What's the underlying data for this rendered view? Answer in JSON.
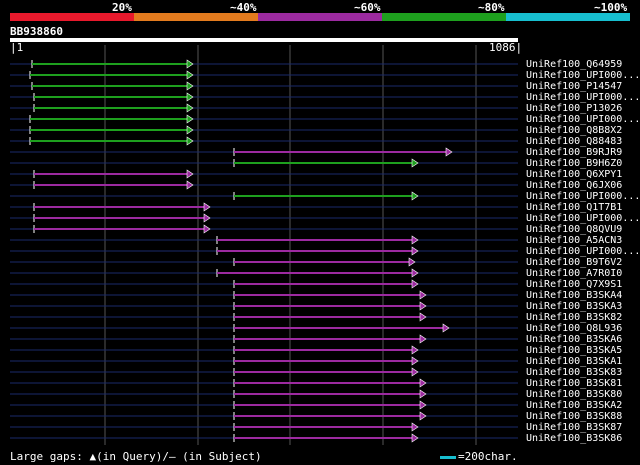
{
  "legend": {
    "labels": [
      "20%",
      "~40%",
      "~60%",
      "~80%",
      "~100%"
    ],
    "colors": [
      "#e8192c",
      "#e37b1e",
      "#9c2aa0",
      "#1ea01e",
      "#17becf"
    ]
  },
  "query": {
    "id": "BB938860",
    "start": "1",
    "end": "1086"
  },
  "footer": {
    "text": "Large gaps: ▲(in Query)/– (in Subject)",
    "scale_label": "=200char."
  },
  "hits": [
    {
      "name": "UniRef100_Q64959",
      "start": 32,
      "end": 193,
      "color": "#1ea01e"
    },
    {
      "name": "UniRef100_UPI000...",
      "start": 30,
      "end": 193,
      "color": "#1ea01e"
    },
    {
      "name": "UniRef100_P14547",
      "start": 32,
      "end": 193,
      "color": "#1ea01e"
    },
    {
      "name": "UniRef100_UPI000...",
      "start": 34,
      "end": 193,
      "color": "#1ea01e"
    },
    {
      "name": "UniRef100_P13026",
      "start": 34,
      "end": 193,
      "color": "#1ea01e"
    },
    {
      "name": "UniRef100_UPI000...",
      "start": 30,
      "end": 193,
      "color": "#1ea01e"
    },
    {
      "name": "UniRef100_Q8B8X2",
      "start": 30,
      "end": 193,
      "color": "#1ea01e"
    },
    {
      "name": "UniRef100_Q88483",
      "start": 30,
      "end": 193,
      "color": "#1ea01e"
    },
    {
      "name": "UniRef100_B9RJR9",
      "start": 234,
      "end": 452,
      "color": "#9c2aa0"
    },
    {
      "name": "UniRef100_B9H6Z0",
      "start": 234,
      "end": 418,
      "color": "#1ea01e"
    },
    {
      "name": "UniRef100_Q6XPY1",
      "start": 34,
      "end": 193,
      "color": "#9c2aa0"
    },
    {
      "name": "UniRef100_Q6JX06",
      "start": 34,
      "end": 193,
      "color": "#9c2aa0"
    },
    {
      "name": "UniRef100_UPI000...",
      "start": 234,
      "end": 418,
      "color": "#1ea01e"
    },
    {
      "name": "UniRef100_Q1T7B1",
      "start": 34,
      "end": 210,
      "color": "#9c2aa0"
    },
    {
      "name": "UniRef100_UPI000...",
      "start": 34,
      "end": 210,
      "color": "#9c2aa0"
    },
    {
      "name": "UniRef100_Q8QVU9",
      "start": 34,
      "end": 210,
      "color": "#9c2aa0"
    },
    {
      "name": "UniRef100_A5ACN3",
      "start": 217,
      "end": 418,
      "color": "#9c2aa0"
    },
    {
      "name": "UniRef100_UPI000...",
      "start": 217,
      "end": 418,
      "color": "#9c2aa0"
    },
    {
      "name": "UniRef100_B9T6V2",
      "start": 234,
      "end": 415,
      "color": "#9c2aa0"
    },
    {
      "name": "UniRef100_A7R0I0",
      "start": 217,
      "end": 418,
      "color": "#9c2aa0"
    },
    {
      "name": "UniRef100_Q7X9S1",
      "start": 234,
      "end": 418,
      "color": "#9c2aa0"
    },
    {
      "name": "UniRef100_B3SKA4",
      "start": 234,
      "end": 426,
      "color": "#9c2aa0"
    },
    {
      "name": "UniRef100_B3SKA3",
      "start": 234,
      "end": 426,
      "color": "#9c2aa0"
    },
    {
      "name": "UniRef100_B3SK82",
      "start": 234,
      "end": 426,
      "color": "#9c2aa0"
    },
    {
      "name": "UniRef100_Q8L936",
      "start": 234,
      "end": 449,
      "color": "#9c2aa0"
    },
    {
      "name": "UniRef100_B3SKA6",
      "start": 234,
      "end": 426,
      "color": "#9c2aa0"
    },
    {
      "name": "UniRef100_B3SKA5",
      "start": 234,
      "end": 418,
      "color": "#9c2aa0"
    },
    {
      "name": "UniRef100_B3SKA1",
      "start": 234,
      "end": 418,
      "color": "#9c2aa0"
    },
    {
      "name": "UniRef100_B3SK83",
      "start": 234,
      "end": 418,
      "color": "#9c2aa0"
    },
    {
      "name": "UniRef100_B3SK81",
      "start": 234,
      "end": 426,
      "color": "#9c2aa0"
    },
    {
      "name": "UniRef100_B3SK80",
      "start": 234,
      "end": 426,
      "color": "#9c2aa0"
    },
    {
      "name": "UniRef100_B3SKA2",
      "start": 234,
      "end": 426,
      "color": "#9c2aa0"
    },
    {
      "name": "UniRef100_B3SK88",
      "start": 234,
      "end": 426,
      "color": "#9c2aa0"
    },
    {
      "name": "UniRef100_B3SK87",
      "start": 234,
      "end": 418,
      "color": "#9c2aa0"
    },
    {
      "name": "UniRef100_B3SK86",
      "start": 234,
      "end": 418,
      "color": "#9c2aa0"
    }
  ]
}
